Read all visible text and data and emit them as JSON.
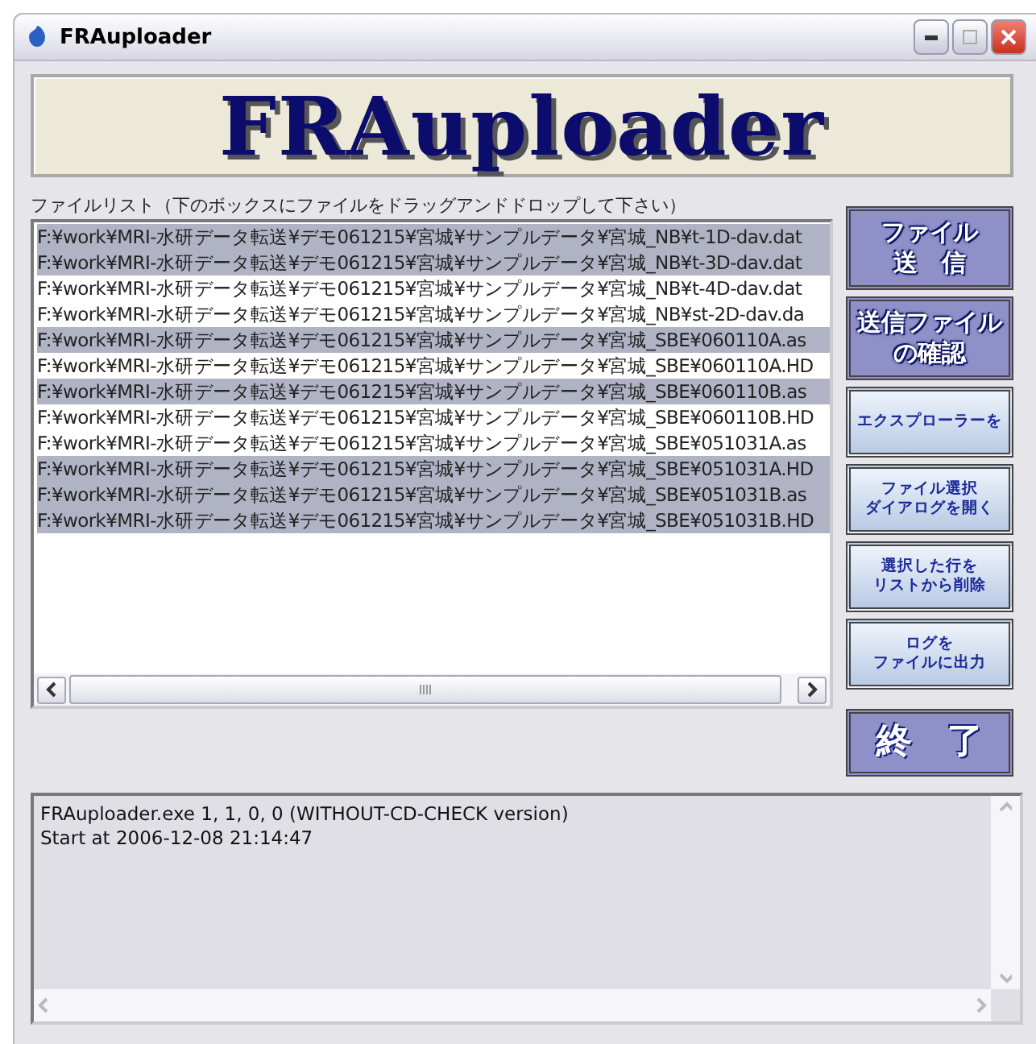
{
  "window": {
    "title": "FRAuploader"
  },
  "banner": {
    "title": "FRAuploader"
  },
  "file_list": {
    "label": "ファイルリスト（下のボックスにファイルをドラッグアンドドロップして下さい）",
    "rows": [
      {
        "text": "F:¥work¥MRI-水研データ転送¥デモ061215¥宮城¥サンプルデータ¥宮城_NB¥t-1D-dav.dat",
        "selected": true
      },
      {
        "text": "F:¥work¥MRI-水研データ転送¥デモ061215¥宮城¥サンプルデータ¥宮城_NB¥t-3D-dav.dat",
        "selected": true
      },
      {
        "text": "F:¥work¥MRI-水研データ転送¥デモ061215¥宮城¥サンプルデータ¥宮城_NB¥t-4D-dav.dat",
        "selected": false
      },
      {
        "text": "F:¥work¥MRI-水研データ転送¥デモ061215¥宮城¥サンプルデータ¥宮城_NB¥st-2D-dav.da",
        "selected": false
      },
      {
        "text": "F:¥work¥MRI-水研データ転送¥デモ061215¥宮城¥サンプルデータ¥宮城_SBE¥060110A.as",
        "selected": true
      },
      {
        "text": "F:¥work¥MRI-水研データ転送¥デモ061215¥宮城¥サンプルデータ¥宮城_SBE¥060110A.HD",
        "selected": false
      },
      {
        "text": "F:¥work¥MRI-水研データ転送¥デモ061215¥宮城¥サンプルデータ¥宮城_SBE¥060110B.as",
        "selected": true
      },
      {
        "text": "F:¥work¥MRI-水研データ転送¥デモ061215¥宮城¥サンプルデータ¥宮城_SBE¥060110B.HD",
        "selected": false
      },
      {
        "text": "F:¥work¥MRI-水研データ転送¥デモ061215¥宮城¥サンプルデータ¥宮城_SBE¥051031A.as",
        "selected": false
      },
      {
        "text": "F:¥work¥MRI-水研データ転送¥デモ061215¥宮城¥サンプルデータ¥宮城_SBE¥051031A.HD",
        "selected": true
      },
      {
        "text": "F:¥work¥MRI-水研データ転送¥デモ061215¥宮城¥サンプルデータ¥宮城_SBE¥051031B.as",
        "selected": true
      },
      {
        "text": "F:¥work¥MRI-水研データ転送¥デモ061215¥宮城¥サンプルデータ¥宮城_SBE¥051031B.HD",
        "selected": true
      }
    ]
  },
  "buttons": [
    {
      "lines": [
        "ファイル",
        "送　信"
      ],
      "kind": "primary"
    },
    {
      "lines": [
        "送信ファイル",
        "の確認"
      ],
      "kind": "primary"
    },
    {
      "lines": [
        "エクスプローラーを"
      ],
      "kind": "secondary"
    },
    {
      "lines": [
        "ファイル選択",
        "ダイアログを開く"
      ],
      "kind": "secondary"
    },
    {
      "lines": [
        "選択した行を",
        "リストから削除"
      ],
      "kind": "secondary"
    },
    {
      "lines": [
        "ログを",
        "ファイルに出力"
      ],
      "kind": "secondary"
    },
    {
      "lines": [
        "終　了"
      ],
      "kind": "exit"
    }
  ],
  "log": {
    "lines": [
      "FRAuploader.exe 1, 1, 0, 0 (WITHOUT-CD-CHECK version)",
      "Start at 2006-12-08 21:14:47"
    ]
  }
}
